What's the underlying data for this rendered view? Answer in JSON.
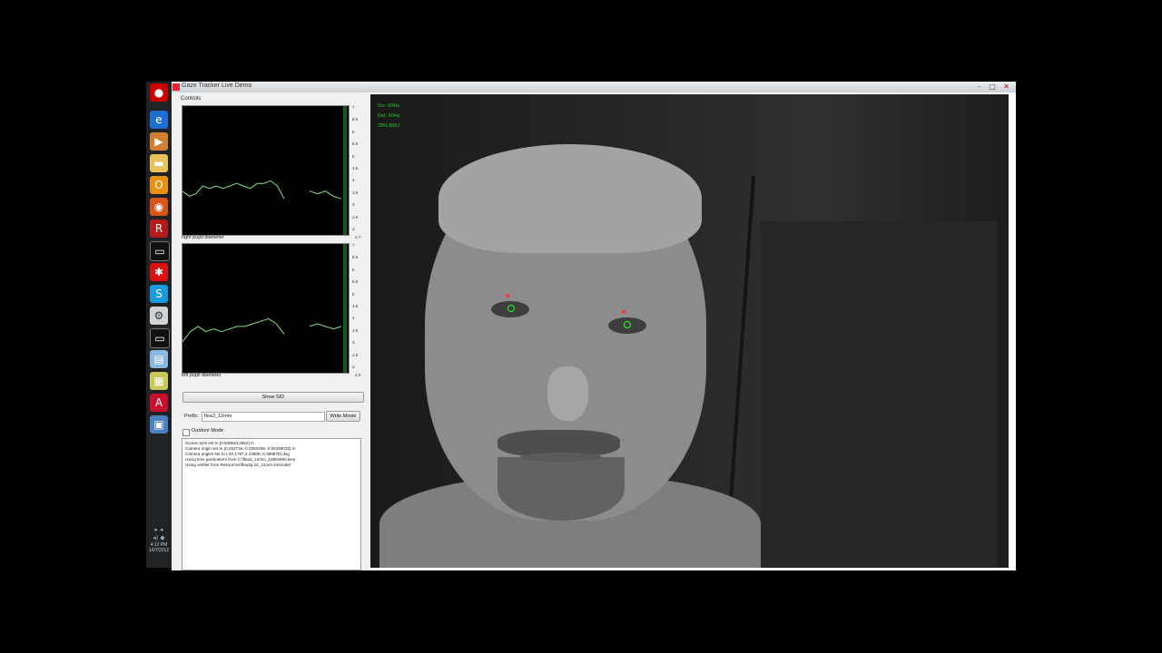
{
  "taskbar": {
    "icons": [
      "ie-icon",
      "media-player-icon",
      "folder-icon",
      "outlook-icon",
      "firefox-icon",
      "app-icon",
      "terminal-icon",
      "spider-icon",
      "skype-icon",
      "tools-icon",
      "cmd-icon",
      "notepad-icon",
      "calculator-icon",
      "acrobat-icon",
      "screen-icon"
    ],
    "clock": "4:12 PM",
    "date": "1/07/2012"
  },
  "window": {
    "title": "Gaze Tracker Live Demo",
    "buttons": {
      "minimize": "–",
      "maximize": "□",
      "close": "✕"
    }
  },
  "controls": {
    "label": "Controls",
    "right_plot": {
      "label": "right pupil diameter",
      "ticks": [
        "7",
        "6.5",
        "6",
        "5.5",
        "5",
        "4.5",
        "4",
        "3.5",
        "3",
        "2.5",
        "2"
      ],
      "readout": "2.7"
    },
    "left_plot": {
      "label": "left pupil diameter",
      "ticks": [
        "7",
        "6.5",
        "6",
        "5.5",
        "5",
        "4.5",
        "4",
        "3.5",
        "3",
        "2.5",
        "2"
      ],
      "readout": "4.0"
    },
    "show_sid": "Show SID",
    "prefix_label": "Prefix:",
    "prefix_value": "flea3_12mm",
    "write_movie": "Write Movie",
    "outdoor_mode": "Outdoor Mode",
    "outdoor_checked": false,
    "log": [
      "Screen size set to [0.5086x0.2862] m",
      "Camera origin set to (0.252716,-0.0363409,-0.00348033) m",
      "Camera angles set to (-20.1797,2.43806,-0.398875) deg",
      "Using lens parameters from C:\\flea3_12mm_1280x960.lens",
      "Using verifier from Resources\\flea3g.24_12mm.smmodel"
    ]
  },
  "video": {
    "info": [
      "Src: 60Hz",
      "Det: 60Hz",
      "28% BRU"
    ]
  },
  "chart_data": [
    {
      "type": "line",
      "title": "right pupil diameter",
      "ylim": [
        2,
        7
      ],
      "series": [
        {
          "values": [
            3.7,
            3.5,
            3.6,
            3.9,
            3.8,
            3.9,
            3.8,
            3.9,
            4.0,
            3.9,
            3.8,
            4.0,
            4.0,
            4.1,
            3.9,
            3.4
          ]
        },
        {
          "values": [
            3.7,
            3.6,
            3.7,
            3.5,
            3.4
          ]
        }
      ]
    },
    {
      "type": "line",
      "title": "left pupil diameter",
      "ylim": [
        2,
        7
      ],
      "series": [
        {
          "values": [
            3.2,
            3.6,
            3.8,
            3.6,
            3.7,
            3.6,
            3.7,
            3.8,
            3.8,
            3.9,
            4.0,
            4.1,
            3.9,
            3.5
          ]
        },
        {
          "values": [
            3.8,
            3.9,
            3.8,
            3.7,
            3.8
          ]
        }
      ]
    }
  ]
}
